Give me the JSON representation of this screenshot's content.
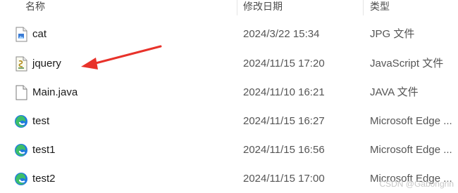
{
  "columns": {
    "name": "名称",
    "date": "修改日期",
    "type": "类型"
  },
  "files": [
    {
      "name": "cat",
      "date": "2024/3/22 15:34",
      "type": "JPG 文件",
      "icon": "jpg-file-icon"
    },
    {
      "name": "jquery",
      "date": "2024/11/15 17:20",
      "type": "JavaScript 文件",
      "icon": "javascript-file-icon"
    },
    {
      "name": "Main.java",
      "date": "2024/11/10 16:21",
      "type": "JAVA 文件",
      "icon": "blank-file-icon"
    },
    {
      "name": "test",
      "date": "2024/11/15 16:27",
      "type": "Microsoft Edge ...",
      "icon": "edge-icon"
    },
    {
      "name": "test1",
      "date": "2024/11/15 16:56",
      "type": "Microsoft Edge ...",
      "icon": "edge-icon"
    },
    {
      "name": "test2",
      "date": "2024/11/15 17:00",
      "type": "Microsoft Edge ...",
      "icon": "edge-icon"
    }
  ],
  "watermark": "CSDN @Gabongrin",
  "colors": {
    "arrow": "#e8322a",
    "edge_blue": "#1f7ae0",
    "edge_green": "#3dbf6a"
  }
}
